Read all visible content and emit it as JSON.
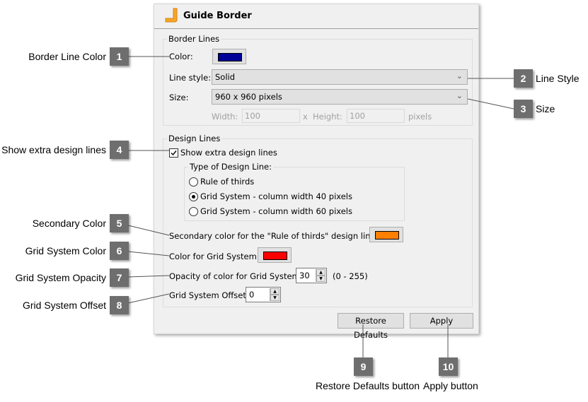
{
  "dialog": {
    "title": "Guide Border",
    "icon": "guide-border-icon",
    "border_lines": {
      "legend": "Border Lines",
      "color_label": "Color:",
      "color_value": "#000099",
      "line_style_label": "Line style:",
      "line_style_value": "Solid",
      "size_label": "Size:",
      "size_value": "960 x 960 pixels",
      "width_label": "Width:",
      "width_value": "100",
      "x_label": "x",
      "height_label": "Height:",
      "height_value": "100",
      "pixels_label": "pixels"
    },
    "design_lines": {
      "legend": "Design Lines",
      "show_extra_label": "Show extra design lines",
      "show_extra_checked": true,
      "type_legend": "Type of Design Line:",
      "options": [
        {
          "label": "Rule of thirds",
          "selected": false
        },
        {
          "label": "Grid System - column width 40 pixels",
          "selected": true
        },
        {
          "label": "Grid System - column width 60 pixels",
          "selected": false
        }
      ],
      "secondary_color_label": "Secondary color for the \"Rule of thirds\" design lines:",
      "secondary_color_value": "#ff8000",
      "grid_color_label": "Color for Grid System:",
      "grid_color_value": "#ff0000",
      "opacity_label": "Opacity of color for Grid System:",
      "opacity_value": "30",
      "opacity_range": "(0 - 255)",
      "offset_label": "Grid System Offset:",
      "offset_value": "0"
    },
    "buttons": {
      "restore_defaults": "Restore Defaults",
      "apply": "Apply"
    }
  },
  "callouts": [
    {
      "number": "1",
      "label": "Border Line Color"
    },
    {
      "number": "2",
      "label": "Line Style"
    },
    {
      "number": "3",
      "label": "Size"
    },
    {
      "number": "4",
      "label": "Show extra design lines"
    },
    {
      "number": "5",
      "label": "Secondary Color"
    },
    {
      "number": "6",
      "label": "Grid System Color"
    },
    {
      "number": "7",
      "label": "Grid System Opacity"
    },
    {
      "number": "8",
      "label": "Grid System Offset"
    },
    {
      "number": "9",
      "label": "Restore Defaults button"
    },
    {
      "number": "10",
      "label": "Apply button"
    }
  ]
}
